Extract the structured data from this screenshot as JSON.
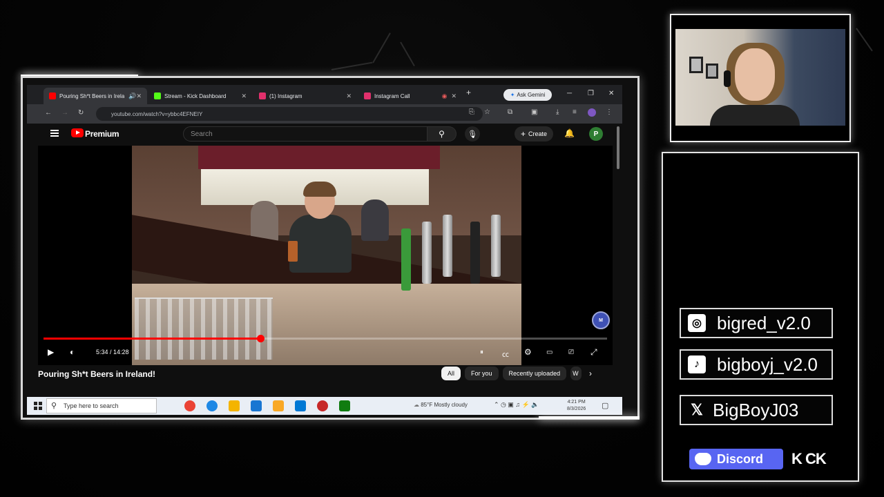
{
  "browser": {
    "tabs": [
      {
        "label": "Pouring Sh*t Beers in Irela...",
        "color": "#ff0000",
        "active": true
      },
      {
        "label": "Stream - Kick Dashboard",
        "color": "#53fc18",
        "active": false
      },
      {
        "label": "(1) Instagram",
        "color": "#e1306c",
        "active": false
      },
      {
        "label": "Instagram Call",
        "color": "#e1306c",
        "active": false
      }
    ],
    "new_tab_icon": "plus-icon",
    "gemini_label": "Ask Gemini",
    "url": "youtube.com/watch?v=ybbc4EFNEIY"
  },
  "youtube": {
    "brand": "Premium",
    "search_placeholder": "Search",
    "create_label": "Create",
    "avatar_letter": "P",
    "player": {
      "current_time": "5:34",
      "duration": "14:28",
      "time_display": "5:34 / 14:28",
      "progress": 0.385
    },
    "video_title": "Pouring Sh*t Beers in Ireland!",
    "chips": [
      "All",
      "For you",
      "Recently uploaded",
      "W"
    ]
  },
  "taskbar": {
    "search_placeholder": "Type here to search",
    "weather": "85°F  Mostly cloudy",
    "time": "4:21 PM",
    "date": "8/3/2026"
  },
  "overlay": {
    "socials": [
      {
        "platform": "instagram",
        "icon": "instagram-icon",
        "handle": "bigred_v2.0"
      },
      {
        "platform": "tiktok",
        "icon": "tiktok-icon",
        "handle": "bigboyj_v2.0"
      },
      {
        "platform": "x",
        "icon": "x-icon",
        "handle": "BigBoyJ03"
      }
    ],
    "discord_label": "Discord",
    "kick_label": "K CK"
  },
  "colors": {
    "accent_red": "#ff0000",
    "discord": "#5865f2",
    "frame": "#e5e5e5"
  }
}
